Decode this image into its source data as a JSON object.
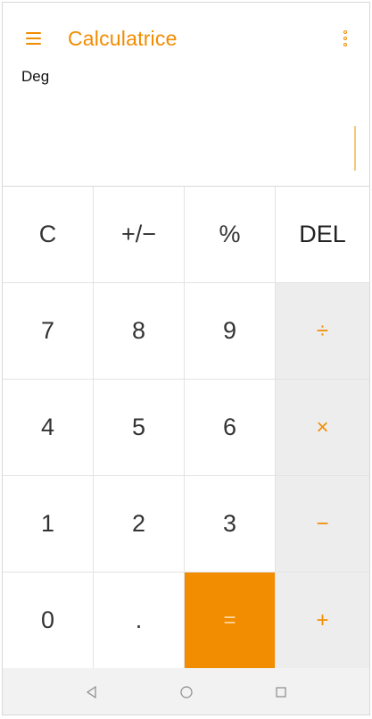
{
  "app": {
    "title": "Calculatrice",
    "mode": "Deg"
  },
  "display": {
    "value": ""
  },
  "keys": [
    {
      "label": "C",
      "kind": "fn"
    },
    {
      "label": "+/−",
      "kind": "fn"
    },
    {
      "label": "%",
      "kind": "fn"
    },
    {
      "label": "DEL",
      "kind": "fn"
    },
    {
      "label": "7",
      "kind": "digit"
    },
    {
      "label": "8",
      "kind": "digit"
    },
    {
      "label": "9",
      "kind": "digit"
    },
    {
      "label": "÷",
      "kind": "op"
    },
    {
      "label": "4",
      "kind": "digit"
    },
    {
      "label": "5",
      "kind": "digit"
    },
    {
      "label": "6",
      "kind": "digit"
    },
    {
      "label": "×",
      "kind": "op"
    },
    {
      "label": "1",
      "kind": "digit"
    },
    {
      "label": "2",
      "kind": "digit"
    },
    {
      "label": "3",
      "kind": "digit"
    },
    {
      "label": "−",
      "kind": "op"
    },
    {
      "label": "0",
      "kind": "digit"
    },
    {
      "label": ".",
      "kind": "digit"
    },
    {
      "label": "=",
      "kind": "eq"
    },
    {
      "label": "+",
      "kind": "op"
    }
  ],
  "colors": {
    "accent": "#f28c00",
    "operator_bg": "#ededed",
    "navbar_bg": "#f2f2f2"
  },
  "icons": {
    "menu": "hamburger-menu-icon",
    "more": "more-vertical-icon",
    "back": "back-triangle-icon",
    "home": "home-circle-icon",
    "recents": "recents-square-icon"
  }
}
